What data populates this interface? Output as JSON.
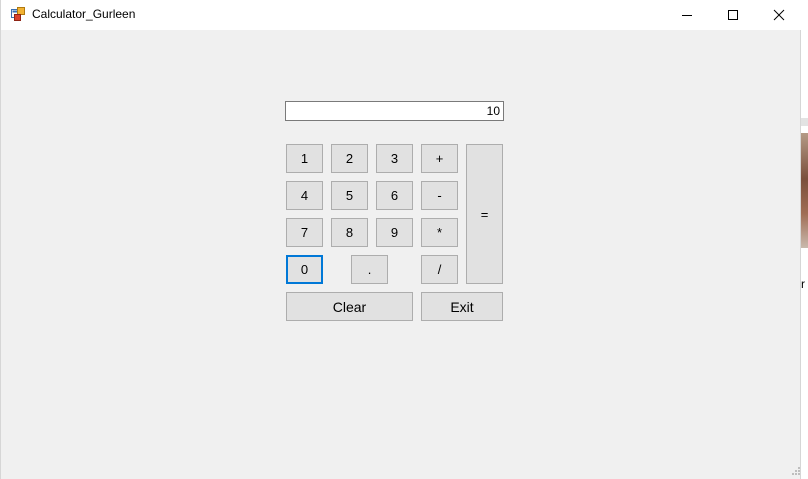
{
  "window": {
    "title": "Calculator_Gurleen",
    "icon": "forms-app-icon",
    "controls": [
      "minimize-icon",
      "maximize-icon",
      "close-icon"
    ]
  },
  "display": {
    "value": "10"
  },
  "buttons": {
    "one": "1",
    "two": "2",
    "three": "3",
    "plus": "+",
    "four": "4",
    "five": "5",
    "six": "6",
    "minus": "-",
    "seven": "7",
    "eight": "8",
    "nine": "9",
    "multiply": "*",
    "zero": "0",
    "dot": ".",
    "divide": "/",
    "equals": "=",
    "clear": "Clear",
    "exit": "Exit"
  },
  "focused_button": "0",
  "background_window": {
    "partial_text": "r"
  },
  "colors": {
    "focus_border": "#0078d7",
    "form_background": "#f0f0f0",
    "button_face": "#e1e1e1"
  }
}
